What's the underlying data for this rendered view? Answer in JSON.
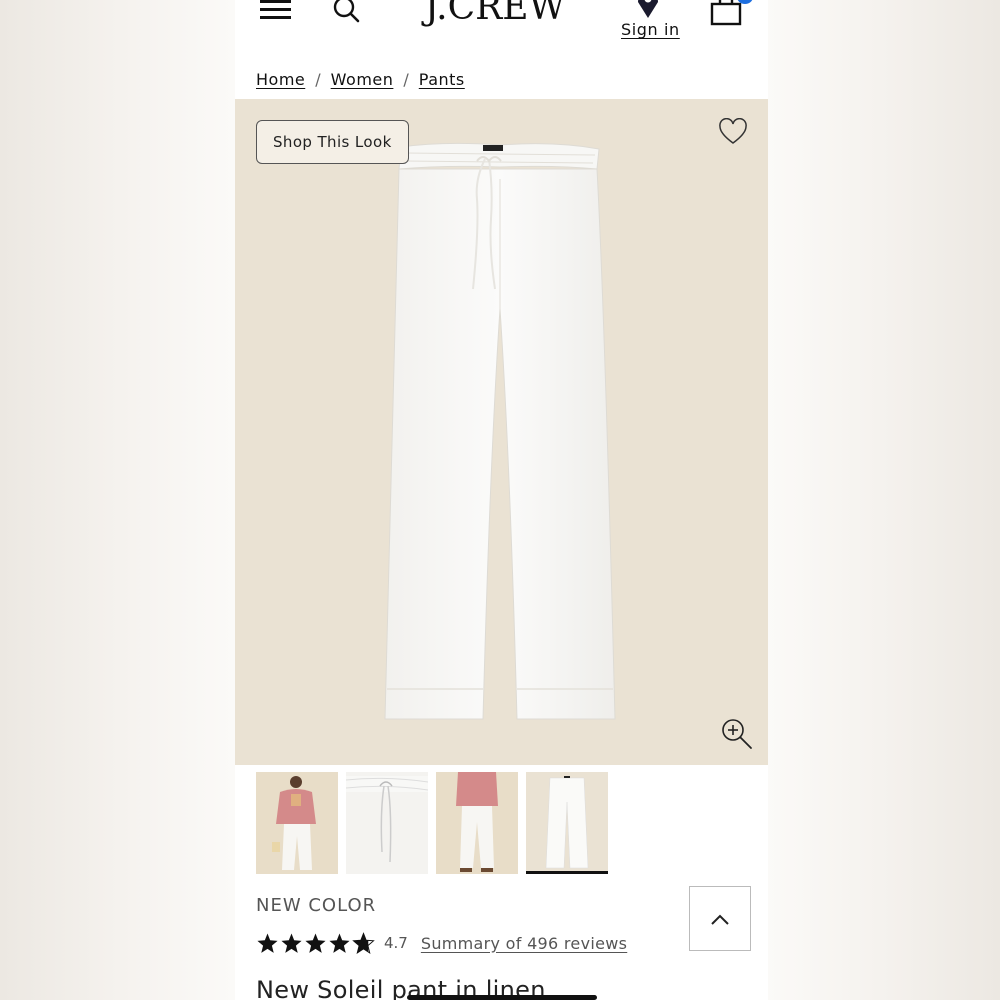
{
  "header": {
    "logo": "J.CREW",
    "signin_label": "Sign in",
    "icons": [
      "menu-icon",
      "search-icon",
      "location-pin-icon",
      "shopping-bag-icon"
    ]
  },
  "breadcrumb": {
    "items": [
      "Home",
      "Women",
      "Pants"
    ],
    "separator": "/"
  },
  "hero": {
    "shop_look_label": "Shop This Look",
    "background_color": "#eae2d3",
    "icons": [
      "heart-icon",
      "zoom-in-icon"
    ]
  },
  "thumbnails": {
    "count": 4,
    "selected_index": 3
  },
  "product": {
    "badge": "NEW COLOR",
    "rating_value": "4.7",
    "stars_filled": 4.7,
    "reviews_link": "Summary of 496 reviews",
    "title": "New Soleil pant in linen"
  },
  "colors": {
    "accent_badge": "#1e6fe0",
    "text_primary": "#111111",
    "text_secondary": "#555555"
  }
}
